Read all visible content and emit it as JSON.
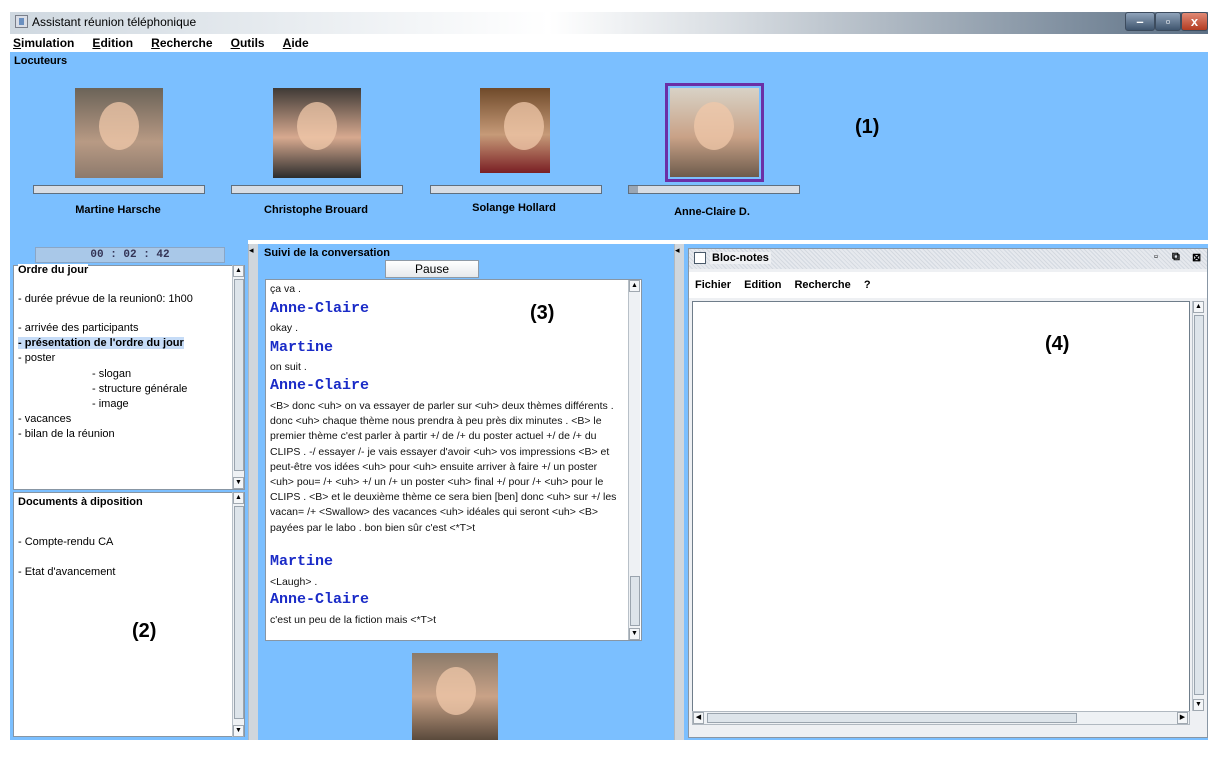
{
  "window": {
    "title": "Assistant réunion téléphonique"
  },
  "menu": [
    "Simulation",
    "Edition",
    "Recherche",
    "Outils",
    "Aide"
  ],
  "speakers_panel": {
    "label": "Locuteurs",
    "annotation": "(1)",
    "speakers": [
      {
        "name": "Martine Harsche",
        "level": 0.0
      },
      {
        "name": "Christophe Brouard",
        "level": 0.0
      },
      {
        "name": "Solange Hollard",
        "level": 0.0
      },
      {
        "name": "Anne-Claire D.",
        "level": 0.05,
        "selected": true
      }
    ]
  },
  "left_panel": {
    "timer": "00 : 02 : 42",
    "annotation": "(2)",
    "agenda": {
      "title": "Ordre du jour",
      "items": [
        "- durée prévue de la reunion0: 1h00",
        "- arrivée des participants",
        "- présentation de l'ordre du jour",
        "- poster",
        "- slogan",
        "- structure générale",
        "- image",
        "- vacances",
        "- bilan de la réunion"
      ]
    },
    "documents": {
      "title": "Documents à diposition",
      "items": [
        "- Compte-rendu CA",
        "- Etat d'avancement"
      ]
    }
  },
  "conversation": {
    "title": "Suivi de la conversation",
    "pause_label": "Pause",
    "annotation": "(3)",
    "entries": [
      {
        "speaker": "",
        "text": "ça va ."
      },
      {
        "speaker": "Anne-Claire",
        "text": "okay ."
      },
      {
        "speaker": "Martine",
        "text": "on suit ."
      },
      {
        "speaker": "Anne-Claire",
        "text": "<B> donc <uh> on va essayer de parler sur <uh> deux thèmes différents . donc <uh> chaque thème nous prendra à peu près dix minutes . <B> le premier thème c'est parler à partir +/ de /+ du poster actuel +/ de /+ du CLIPS . -/ essayer /- je vais essayer d'avoir <uh> vos impressions <B> et peut-être vos idées <uh> pour <uh> ensuite arriver à faire +/ un poster <uh> pou= /+ <uh> +/ un /+ un poster <uh> final +/ pour /+ <uh> pour le CLIPS . <B> et le deuxième thème ce sera bien [ben] donc <uh> sur +/ les vacan= /+ <Swallow> des vacances <uh> idéales qui seront <uh> <B> payées par le labo . bon bien sûr c'est <*T>t"
      },
      {
        "speaker": "Martine",
        "text": "<Laugh> ."
      },
      {
        "speaker": "Anne-Claire",
        "text": "c'est un peu de la fiction mais <*T>t"
      }
    ]
  },
  "notepad": {
    "title": "Bloc-notes",
    "annotation": "(4)",
    "menu": [
      "Fichier",
      "Edition",
      "Recherche",
      "?"
    ],
    "content": ""
  }
}
